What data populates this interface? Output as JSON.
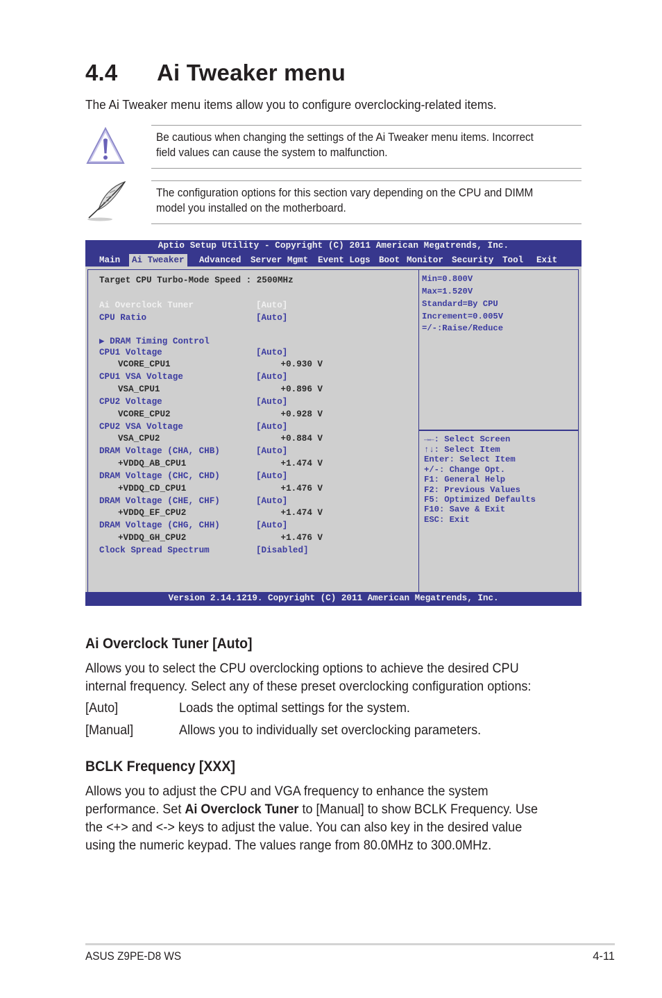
{
  "heading": {
    "number": "4.4",
    "title": "Ai Tweaker menu"
  },
  "intro": "The Ai Tweaker menu items allow you to configure overclocking-related items.",
  "notes": [
    {
      "icon": "warning-icon",
      "lines": [
        "Be cautious when changing the settings of the Ai Tweaker menu items. Incorrect",
        "field values can cause the system to malfunction."
      ]
    },
    {
      "icon": "note-feather-icon",
      "lines": [
        "The configuration options for this section vary depending on the CPU and DIMM",
        "model you installed on the motherboard."
      ]
    }
  ],
  "bios": {
    "title": "Aptio Setup Utility - Copyright (C) 2011 American Megatrends, Inc.",
    "menu": [
      "Main",
      "Ai Tweaker",
      "Advanced",
      "Server Mgmt",
      "Event Logs",
      "Boot",
      "Monitor",
      "Security",
      "Tool",
      "Exit"
    ],
    "active_menu": "Ai Tweaker",
    "target_speed": "Target CPU Turbo-Mode Speed : 2500MHz",
    "items": [
      {
        "label": "Ai Overclock Tuner",
        "value": "[Auto]",
        "selected": true
      },
      {
        "label": "CPU Ratio",
        "value": "[Auto]"
      },
      {
        "label": "DRAM Timing Control",
        "submenu": true
      },
      {
        "label": "CPU1 Voltage",
        "value": "[Auto]"
      },
      {
        "label": "VCORE_CPU1",
        "reading": "+0.930 V"
      },
      {
        "label": "CPU1 VSA Voltage",
        "value": "[Auto]"
      },
      {
        "label": "VSA_CPU1",
        "reading": "+0.896 V"
      },
      {
        "label": "CPU2 Voltage",
        "value": "[Auto]"
      },
      {
        "label": "VCORE_CPU2",
        "reading": "+0.928 V"
      },
      {
        "label": "CPU2 VSA Voltage",
        "value": "[Auto]"
      },
      {
        "label": "VSA_CPU2",
        "reading": "+0.884 V"
      },
      {
        "label": "DRAM Voltage (CHA, CHB)",
        "value": "[Auto]"
      },
      {
        "label": "+VDDQ_AB_CPU1",
        "reading": "+1.474 V"
      },
      {
        "label": "DRAM Voltage (CHC, CHD)",
        "value": "[Auto]"
      },
      {
        "label": "+VDDQ_CD_CPU1",
        "reading": "+1.476 V"
      },
      {
        "label": "DRAM Voltage (CHE, CHF)",
        "value": "[Auto]"
      },
      {
        "label": "+VDDQ_EF_CPU2",
        "reading": "+1.474 V"
      },
      {
        "label": "DRAM Voltage (CHG, CHH)",
        "value": "[Auto]"
      },
      {
        "label": "+VDDQ_GH_CPU2",
        "reading": "+1.476 V"
      },
      {
        "label": "Clock Spread Spectrum",
        "value": "[Disabled]"
      }
    ],
    "help": [
      "Min=0.800V",
      "Max=1.520V",
      "Standard=By CPU",
      "Increment=0.005V",
      "=/-:Raise/Reduce"
    ],
    "keys": [
      "→←: Select Screen",
      "↑↓:  Select Item",
      "Enter: Select Item",
      "+/-: Change Opt.",
      "F1: General Help",
      "F2: Previous Values",
      "F5: Optimized Defaults",
      "F10: Save & Exit",
      "ESC: Exit"
    ],
    "footer": "Version 2.14.1219. Copyright (C) 2011 American Megatrends, Inc.",
    "colors": {
      "bar": "#37378d",
      "panel": "#cfcfcf",
      "item": "#3c3ca0"
    }
  },
  "sections": [
    {
      "title": "Ai Overclock Tuner [Auto]",
      "lines": [
        "Allows you to select the CPU overclocking options to achieve the desired CPU",
        "internal frequency. Select any of these preset overclocking configuration options:"
      ],
      "options": [
        {
          "key": "[Auto]",
          "desc": "Loads the optimal settings for the system."
        },
        {
          "key": "[Manual]",
          "desc": "Allows you to individually set overclocking parameters."
        }
      ]
    },
    {
      "title": "BCLK Frequency [XXX]",
      "line1": "Allows you to adjust the CPU and VGA frequency to enhance the system",
      "line2_pre": "performance. Set ",
      "line2_bold": "Ai Overclock Tuner",
      "line2_post": " to [Manual] to show BCLK Frequency. Use",
      "line3": "the <+> and <-> keys to adjust the value. You can also key in the desired value",
      "line4": "using the numeric keypad. The values range from 80.0MHz to 300.0MHz."
    }
  ],
  "footer": {
    "left": "ASUS Z9PE-D8 WS",
    "right": "4-11"
  }
}
